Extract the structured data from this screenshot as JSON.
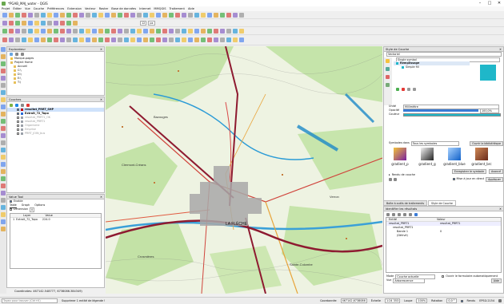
{
  "window": {
    "title": "*PGAB_MAJ_water - QGIS"
  },
  "menu": [
    "Projet",
    "Éditer",
    "Vue",
    "Couche",
    "Préférences",
    "Extension",
    "Vecteur",
    "Raster",
    "Base de données",
    "Internet",
    "MMQGIS",
    "Traitement",
    "Aide"
  ],
  "toolbar": {
    "scale_value": "12",
    "unit": "px"
  },
  "explorer": {
    "title": "Explorateur",
    "items": [
      "Marque-pages",
      "Project Home",
      "Accueil",
      "C:\\",
      "D:\\",
      "E:\\",
      "T:\\"
    ]
  },
  "layers": {
    "title": "Couches",
    "items": [
      {
        "label": "resultat_PRRT_SHP",
        "checked": true,
        "selected": true,
        "color": "#c00000"
      },
      {
        "label": "Extrait_72_Topo",
        "checked": true,
        "bold": true,
        "color": "#2a6bd6"
      },
      {
        "label": "resultat_PRRT1_OK",
        "checked": false,
        "color": "#9aa0a8"
      },
      {
        "label": "resultat_PRRT1",
        "checked": false,
        "color": "#9aa0a8"
      },
      {
        "label": "Organisme",
        "checked": false,
        "color": "#9aa0a8"
      },
      {
        "label": "Emprise",
        "checked": false,
        "color": "#9aa0a8"
      },
      {
        "label": "PRRT_JOIN_bus",
        "checked": false,
        "color": "#9aa0a8"
      }
    ]
  },
  "value_tool": {
    "title": "Value Tool",
    "enable_label": "Enable",
    "tabs": [
      "Table",
      "Graph",
      "Options"
    ],
    "dimension_label": "Dimension",
    "dimension_value": "0",
    "col_layer": "Layer",
    "col_value": "Value",
    "rows": [
      {
        "idx": "1",
        "layer": "Extrait_72_Topo",
        "value": "224.0"
      }
    ]
  },
  "coords": {
    "text": "Coordinates: 467142.548777, 6738086.384349)"
  },
  "style_panel": {
    "title": "Style de Couche",
    "layer": "Vectoriel",
    "renderer": "Single symbol",
    "symbol_root": "Remplissage",
    "symbol_child": "Simple fill",
    "fill_color": "#1fb7c9",
    "unit_label": "Unité",
    "unit_value": "Millimètre",
    "opacity_label": "Opacité",
    "opacity_value": "100,0%",
    "color_label": "Couleur",
    "symbols_label": "Symboles dans",
    "symbols_value": "Tous les symboles",
    "library_button": "Ouvrir la bibliothèque",
    "gradients": [
      {
        "name": "gradient_p",
        "c1": "#f2c23a",
        "c2": "#7a1fa0"
      },
      {
        "name": "gradient_g",
        "c1": "#f4f4f4",
        "c2": "#222"
      },
      {
        "name": "gradient_blue",
        "c1": "#a8d2ff",
        "c2": "#1060c8"
      },
      {
        "name": "gradient_brc",
        "c1": "#d08a58",
        "c2": "#6a2a1a"
      }
    ],
    "save_symbol_button": "Enregistrer le symbole",
    "advanced_button": "Avancé",
    "rendering_label": "Rendu de couche",
    "live_label": "Mise à jour en direct",
    "apply_button": "Appliquer",
    "bottom_tabs": [
      "Boîte à outils de traitements",
      "Style de Couche"
    ]
  },
  "identify": {
    "title": "Identifier les résultats",
    "col_entity": "Entité",
    "col_value": "Valeur",
    "tree": [
      {
        "label": "resultat_PRRT1",
        "value": "resultat_PRRT1",
        "level": 0
      },
      {
        "label": "resultat_PRRT1",
        "value": "",
        "level": 1
      },
      {
        "label": "Bande 1",
        "value": "0",
        "level": 2
      },
      {
        "label": "(Dérivé)",
        "value": "",
        "level": 2
      }
    ],
    "mode_label": "Mode",
    "mode_value": "Couche actuelle",
    "auto_form_label": "Ouvrir le formulaire automatiquement",
    "view_label": "Vue",
    "view_value": "Arborescence",
    "help_button": "Aide"
  },
  "map_labels": [
    "LA FLÈCHE",
    "Crosmières",
    "Clermont-Créans",
    "Bazouges",
    "Sainte-Colombe",
    "Verron"
  ],
  "status": {
    "search_placeholder": "Tapez pour trouver (Ctrl+K)",
    "message": "Supprimer 1 entité de légende !",
    "coord_label": "Coordonnée",
    "coord_value": "467142,6738086",
    "scale_label": "Échelle",
    "scale_value": "1:24 353",
    "zoom_label": "Loupe",
    "zoom_value": "100%",
    "rotation_label": "Rotation",
    "rotation_value": "0,0 °",
    "render_label": "Rendu",
    "crs": "EPSG:2154"
  }
}
